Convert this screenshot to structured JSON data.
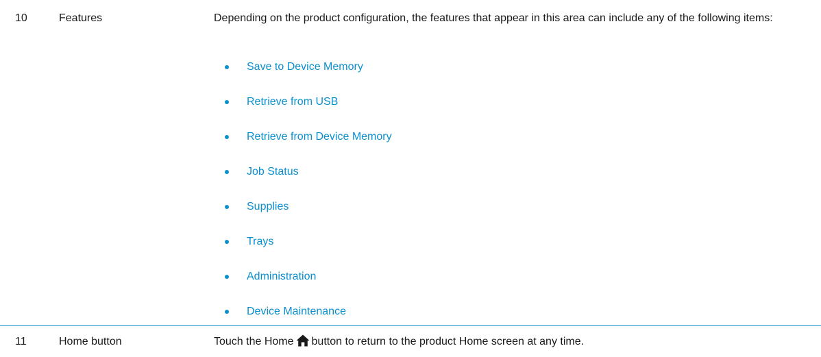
{
  "rows": [
    {
      "number": "10",
      "feature": "Features",
      "description": "Depending on the product configuration, the features that appear in this area can include any of the following items:",
      "items": [
        "Save to Device Memory",
        "Retrieve from USB",
        "Retrieve from Device Memory",
        "Job Status",
        "Supplies",
        "Trays",
        "Administration",
        "Device Maintenance"
      ]
    },
    {
      "number": "11",
      "feature": "Home button",
      "description_before": "Touch the Home",
      "icon": "home-icon",
      "description_after": "button to return to the product Home screen at any time."
    }
  ],
  "colors": {
    "link": "#0a8fcf",
    "text": "#1a1a1a",
    "divider": "#0a8fcf"
  }
}
